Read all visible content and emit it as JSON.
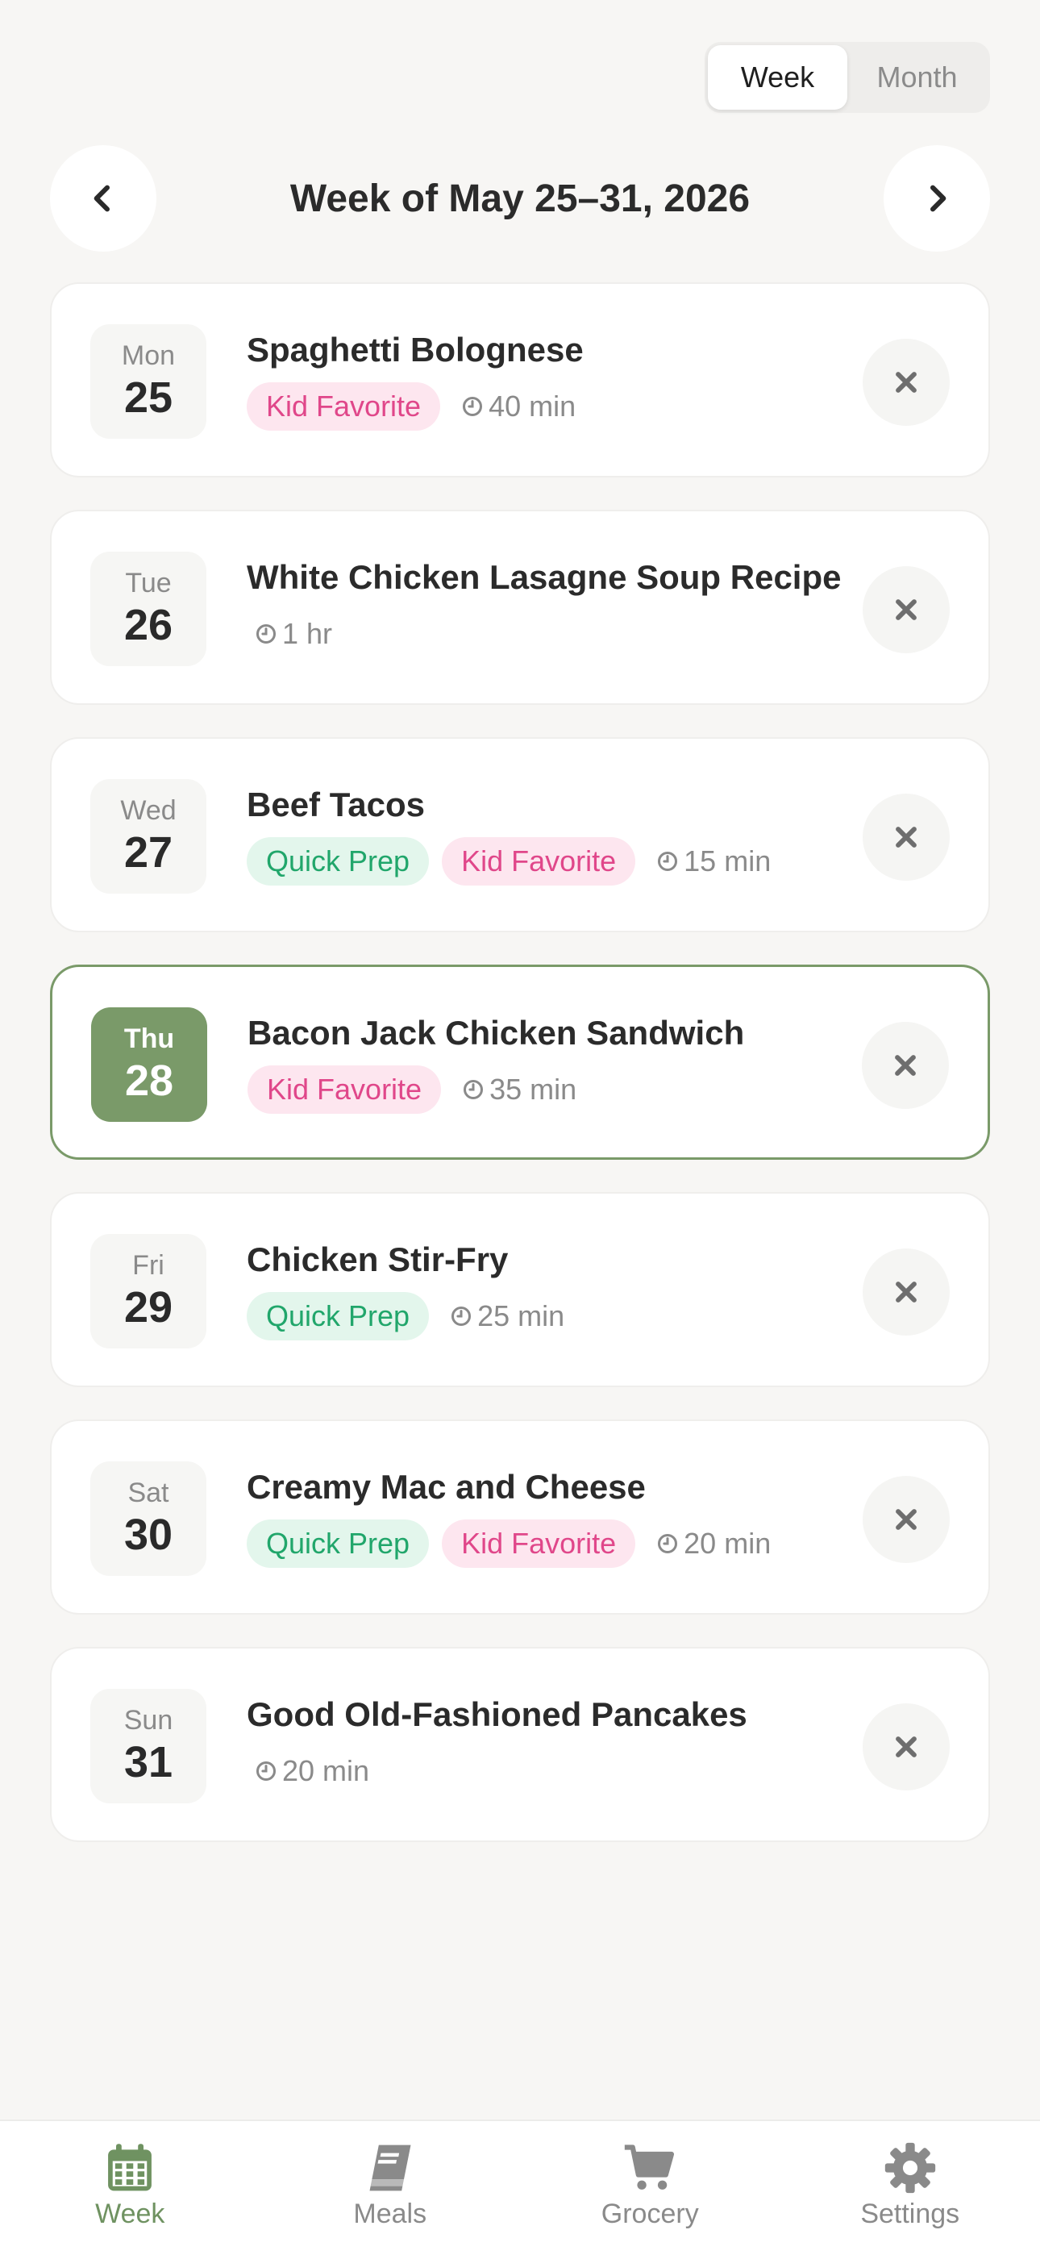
{
  "view_toggle": {
    "week_label": "Week",
    "month_label": "Month",
    "active": "Week"
  },
  "week_nav": {
    "title": "Week of May 25–31, 2026",
    "prev_icon": "chevron-left-icon",
    "next_icon": "chevron-right-icon"
  },
  "meals": [
    {
      "day": "Mon",
      "date": "25",
      "title": "Spaghetti Bolognese",
      "tags": [
        "Kid Favorite"
      ],
      "time": "40 min",
      "today": false
    },
    {
      "day": "Tue",
      "date": "26",
      "title": "White Chicken Lasagne Soup Recipe",
      "tags": [],
      "time": "1 hr",
      "today": false
    },
    {
      "day": "Wed",
      "date": "27",
      "title": "Beef Tacos",
      "tags": [
        "Quick Prep",
        "Kid Favorite"
      ],
      "time": "15 min",
      "today": false
    },
    {
      "day": "Thu",
      "date": "28",
      "title": "Bacon Jack Chicken Sandwich",
      "tags": [
        "Kid Favorite"
      ],
      "time": "35 min",
      "today": true
    },
    {
      "day": "Fri",
      "date": "29",
      "title": "Chicken Stir-Fry",
      "tags": [
        "Quick Prep"
      ],
      "time": "25 min",
      "today": false
    },
    {
      "day": "Sat",
      "date": "30",
      "title": "Creamy Mac and Cheese",
      "tags": [
        "Quick Prep",
        "Kid Favorite"
      ],
      "time": "20 min",
      "today": false
    },
    {
      "day": "Sun",
      "date": "31",
      "title": "Good Old-Fashioned Pancakes",
      "tags": [],
      "time": "20 min",
      "today": false
    }
  ],
  "tab_bar": {
    "active": "Week",
    "tabs": [
      {
        "label": "Week",
        "icon": "calendar-icon"
      },
      {
        "label": "Meals",
        "icon": "book-icon"
      },
      {
        "label": "Grocery",
        "icon": "cart-icon"
      },
      {
        "label": "Settings",
        "icon": "gear-icon"
      }
    ]
  },
  "colors": {
    "accent": "#7a9a69",
    "kid_tag_bg": "#fde6ef",
    "kid_tag_text": "#e0478a",
    "quick_tag_bg": "#e3f6ec",
    "quick_tag_text": "#21a66b",
    "background": "#f7f6f4"
  }
}
